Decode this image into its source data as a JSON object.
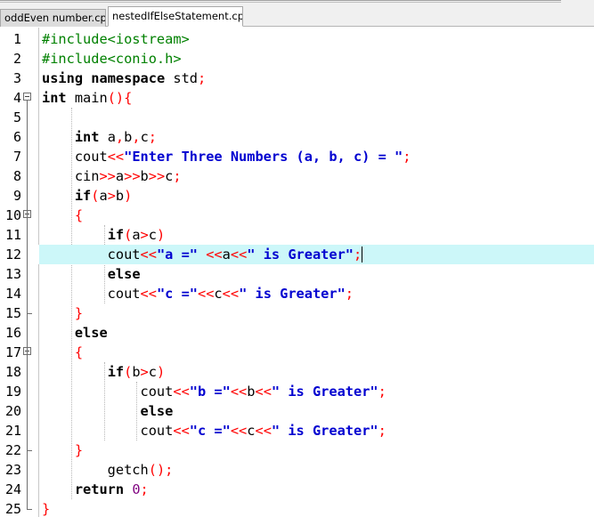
{
  "tabs": [
    {
      "label": "oddEven number.cpp",
      "active": false
    },
    {
      "label": "nestedIfElseStatement.cpp",
      "active": true
    }
  ],
  "editor": {
    "current_line": 12,
    "lines": [
      {
        "n": "1",
        "tokens": [
          [
            "pp",
            "#include<iostream>"
          ]
        ]
      },
      {
        "n": "2",
        "tokens": [
          [
            "pp",
            "#include<conio.h>"
          ]
        ]
      },
      {
        "n": "3",
        "tokens": [
          [
            "kw",
            "using"
          ],
          [
            "id",
            " "
          ],
          [
            "kw",
            "namespace"
          ],
          [
            "id",
            " std"
          ],
          [
            "op",
            ";"
          ]
        ]
      },
      {
        "n": "4",
        "tokens": [
          [
            "kw",
            "int"
          ],
          [
            "id",
            " main"
          ],
          [
            "op",
            "(){"
          ]
        ]
      },
      {
        "n": "5",
        "tokens": []
      },
      {
        "n": "6",
        "tokens": [
          [
            "id",
            "    "
          ],
          [
            "kw",
            "int"
          ],
          [
            "id",
            " a"
          ],
          [
            "op",
            ","
          ],
          [
            "id",
            "b"
          ],
          [
            "op",
            ","
          ],
          [
            "id",
            "c"
          ],
          [
            "op",
            ";"
          ]
        ]
      },
      {
        "n": "7",
        "tokens": [
          [
            "id",
            "    cout"
          ],
          [
            "op",
            "<<"
          ],
          [
            "str",
            "\"Enter Three Numbers (a, b, c) = \""
          ],
          [
            "op",
            ";"
          ]
        ]
      },
      {
        "n": "8",
        "tokens": [
          [
            "id",
            "    cin"
          ],
          [
            "op",
            ">>"
          ],
          [
            "id",
            "a"
          ],
          [
            "op",
            ">>"
          ],
          [
            "id",
            "b"
          ],
          [
            "op",
            ">>"
          ],
          [
            "id",
            "c"
          ],
          [
            "op",
            ";"
          ]
        ]
      },
      {
        "n": "9",
        "tokens": [
          [
            "id",
            "    "
          ],
          [
            "kw",
            "if"
          ],
          [
            "op",
            "("
          ],
          [
            "id",
            "a"
          ],
          [
            "op",
            ">"
          ],
          [
            "id",
            "b"
          ],
          [
            "op",
            ")"
          ]
        ]
      },
      {
        "n": "10",
        "tokens": [
          [
            "id",
            "    "
          ],
          [
            "op",
            "{"
          ]
        ]
      },
      {
        "n": "11",
        "tokens": [
          [
            "id",
            "        "
          ],
          [
            "kw",
            "if"
          ],
          [
            "op",
            "("
          ],
          [
            "id",
            "a"
          ],
          [
            "op",
            ">"
          ],
          [
            "id",
            "c"
          ],
          [
            "op",
            ")"
          ]
        ]
      },
      {
        "n": "12",
        "tokens": [
          [
            "id",
            "        cout"
          ],
          [
            "op",
            "<<"
          ],
          [
            "str",
            "\"a =\""
          ],
          [
            "id",
            " "
          ],
          [
            "op",
            "<<"
          ],
          [
            "id",
            "a"
          ],
          [
            "op",
            "<<"
          ],
          [
            "str",
            "\" is Greater\""
          ],
          [
            "op",
            ";"
          ]
        ],
        "caret": true
      },
      {
        "n": "13",
        "tokens": [
          [
            "id",
            "        "
          ],
          [
            "kw",
            "else"
          ]
        ]
      },
      {
        "n": "14",
        "tokens": [
          [
            "id",
            "        cout"
          ],
          [
            "op",
            "<<"
          ],
          [
            "str",
            "\"c =\""
          ],
          [
            "op",
            "<<"
          ],
          [
            "id",
            "c"
          ],
          [
            "op",
            "<<"
          ],
          [
            "str",
            "\" is Greater\""
          ],
          [
            "op",
            ";"
          ]
        ]
      },
      {
        "n": "15",
        "tokens": [
          [
            "id",
            "    "
          ],
          [
            "op",
            "}"
          ]
        ]
      },
      {
        "n": "16",
        "tokens": [
          [
            "id",
            "    "
          ],
          [
            "kw",
            "else"
          ]
        ]
      },
      {
        "n": "17",
        "tokens": [
          [
            "id",
            "    "
          ],
          [
            "op",
            "{"
          ]
        ]
      },
      {
        "n": "18",
        "tokens": [
          [
            "id",
            "        "
          ],
          [
            "kw",
            "if"
          ],
          [
            "op",
            "("
          ],
          [
            "id",
            "b"
          ],
          [
            "op",
            ">"
          ],
          [
            "id",
            "c"
          ],
          [
            "op",
            ")"
          ]
        ]
      },
      {
        "n": "19",
        "tokens": [
          [
            "id",
            "            cout"
          ],
          [
            "op",
            "<<"
          ],
          [
            "str",
            "\"b =\""
          ],
          [
            "op",
            "<<"
          ],
          [
            "id",
            "b"
          ],
          [
            "op",
            "<<"
          ],
          [
            "str",
            "\" is Greater\""
          ],
          [
            "op",
            ";"
          ]
        ]
      },
      {
        "n": "20",
        "tokens": [
          [
            "id",
            "            "
          ],
          [
            "kw",
            "else"
          ]
        ]
      },
      {
        "n": "21",
        "tokens": [
          [
            "id",
            "            cout"
          ],
          [
            "op",
            "<<"
          ],
          [
            "str",
            "\"c =\""
          ],
          [
            "op",
            "<<"
          ],
          [
            "id",
            "c"
          ],
          [
            "op",
            "<<"
          ],
          [
            "str",
            "\" is Greater\""
          ],
          [
            "op",
            ";"
          ]
        ]
      },
      {
        "n": "22",
        "tokens": [
          [
            "id",
            "    "
          ],
          [
            "op",
            "}"
          ]
        ]
      },
      {
        "n": "23",
        "tokens": [
          [
            "id",
            "        getch"
          ],
          [
            "op",
            "();"
          ]
        ]
      },
      {
        "n": "24",
        "tokens": [
          [
            "id",
            "    "
          ],
          [
            "kw",
            "return"
          ],
          [
            "id",
            " "
          ],
          [
            "num",
            "0"
          ],
          [
            "op",
            ";"
          ]
        ]
      },
      {
        "n": "25",
        "tokens": [
          [
            "op",
            "}"
          ]
        ]
      }
    ]
  }
}
